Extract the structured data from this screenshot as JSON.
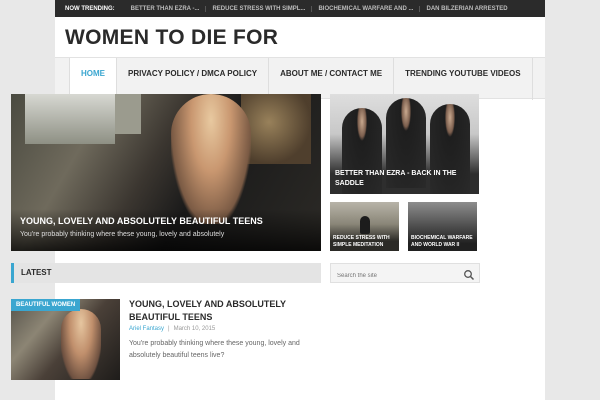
{
  "trending": {
    "label": "Now Trending:",
    "items": [
      "Better than Ezra -...",
      "Reduce Stress with Simpl...",
      "Biochemical Warfare and ...",
      "Dan Bilzerian Arrested"
    ]
  },
  "site": {
    "title": "WOMEN TO DIE FOR"
  },
  "nav": {
    "items": [
      "Home",
      "Privacy Policy / DMCA Policy",
      "About Me / Contact Me",
      "Trending YouTube Videos"
    ],
    "active_index": 0
  },
  "featured": {
    "main": {
      "title": "Young, Lovely and Absolutely Beautiful Teens",
      "excerpt": "You're probably thinking where these young, lovely and absolutely"
    },
    "right_top": {
      "title": "Better than Ezra - Back in the Saddle"
    },
    "small_1": {
      "title": "Reduce Stress with Simple Meditation"
    },
    "small_2": {
      "title": "Biochemical Warfare and World War II"
    }
  },
  "latest": {
    "heading": "Latest"
  },
  "search": {
    "placeholder": "Search the site"
  },
  "post": {
    "category": "Beautiful Women",
    "title": "Young, Lovely and Absolutely Beautiful Teens",
    "author": "Ariel Fantasy",
    "separator": "|",
    "date": "March 10, 2015",
    "excerpt": "You're probably thinking where these young, lovely and absolutely beautiful teens live?"
  },
  "colors": {
    "accent": "#3aa6d0",
    "topbar": "#2b2b2b",
    "background": "#e8e8e8"
  }
}
